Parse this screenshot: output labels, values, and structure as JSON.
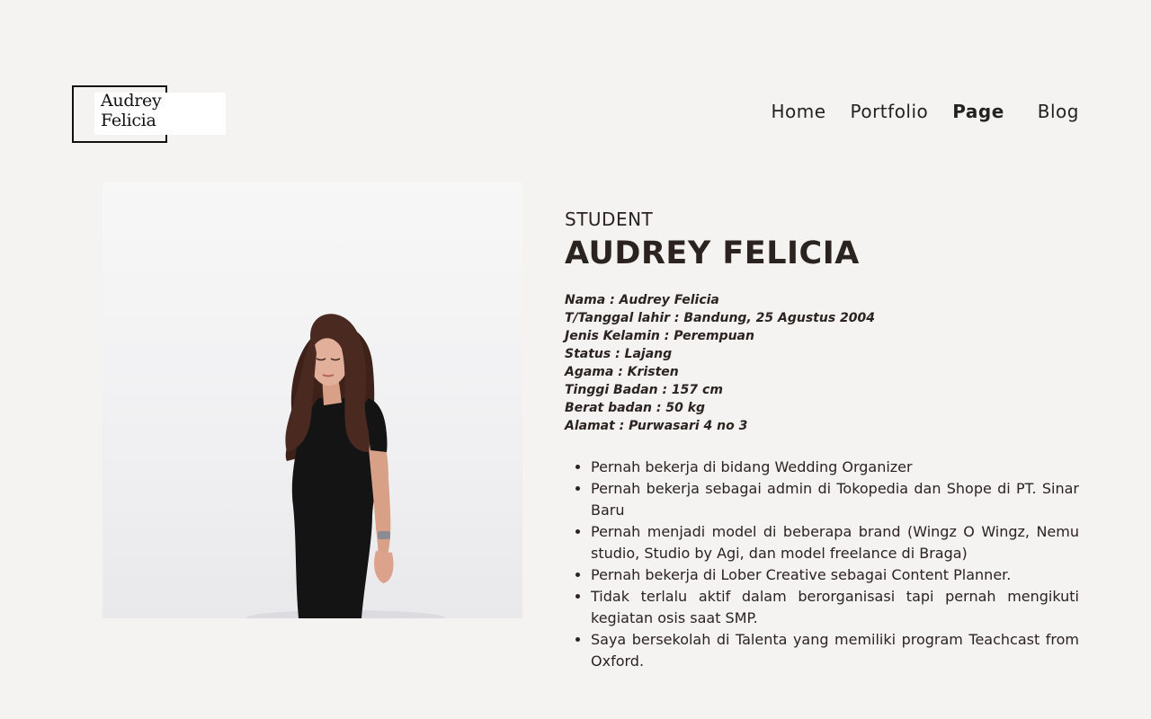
{
  "logo": {
    "line1": "Audrey",
    "line2": "Felicia"
  },
  "nav": {
    "items": [
      {
        "label": "Home"
      },
      {
        "label": "Portfolio"
      },
      {
        "label": "Page"
      },
      {
        "label": "Blog"
      }
    ],
    "active": "Page"
  },
  "profile": {
    "role": "STUDENT",
    "name": "AUDREY FELICIA",
    "details": [
      "Nama : Audrey Felicia",
      "T/Tanggal lahir : Bandung, 25 Agustus 2004",
      "Jenis Kelamin : Perempuan",
      "Status : Lajang",
      "Agama : Kristen",
      "Tinggi Badan : 157 cm",
      "Berat badan : 50 kg",
      "Alamat : Purwasari 4 no 3"
    ],
    "bullets": [
      "Pernah bekerja di bidang Wedding Organizer",
      "Pernah bekerja sebagai admin di Tokopedia dan Shope di PT. Sinar Baru",
      "Pernah menjadi model di beberapa brand (Wingz O Wingz, Nemu studio, Studio by Agi, dan model freelance di Braga)",
      "Pernah bekerja di Lober Creative sebagai Content Planner.",
      "Tidak terlalu aktif dalam berorganisasi tapi pernah mengikuti kegiatan osis saat SMP.",
      "Saya bersekolah di Talenta yang memiliki program Teachcast from Oxford."
    ]
  },
  "colors": {
    "background": "#f4f3f1",
    "text": "#2b2320",
    "logo_border": "#111111",
    "dress": "#121212",
    "hair": "#4a2a20"
  }
}
